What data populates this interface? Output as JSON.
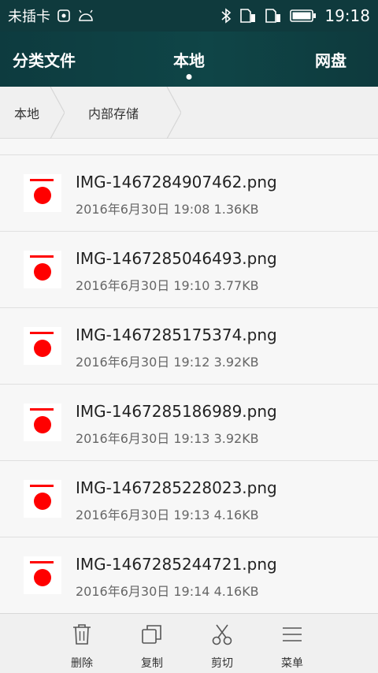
{
  "status_bar": {
    "carrier": "未插卡",
    "time": "19:18"
  },
  "header": {
    "tabs": [
      {
        "label": "分类文件"
      },
      {
        "label": "本地"
      },
      {
        "label": "网盘"
      }
    ]
  },
  "breadcrumb": [
    "本地",
    "内部存储"
  ],
  "files": [
    {
      "name": "IMG-1467284907462.png",
      "date": "2016年6月30日 19:08",
      "size": "1.36KB"
    },
    {
      "name": "IMG-1467285046493.png",
      "date": "2016年6月30日 19:10",
      "size": "3.77KB"
    },
    {
      "name": "IMG-1467285175374.png",
      "date": "2016年6月30日 19:12",
      "size": "3.92KB"
    },
    {
      "name": "IMG-1467285186989.png",
      "date": "2016年6月30日 19:13",
      "size": "3.92KB"
    },
    {
      "name": "IMG-1467285228023.png",
      "date": "2016年6月30日 19:13",
      "size": "4.16KB"
    },
    {
      "name": "IMG-1467285244721.png",
      "date": "2016年6月30日 19:14",
      "size": "4.16KB"
    }
  ],
  "bottom_actions": [
    {
      "label": "删除",
      "icon": "trash-icon"
    },
    {
      "label": "复制",
      "icon": "copy-icon"
    },
    {
      "label": "剪切",
      "icon": "scissors-icon"
    },
    {
      "label": "菜单",
      "icon": "menu-icon"
    }
  ],
  "colors": {
    "header_bg": "#0f4547",
    "thumb_red": "#ff0000"
  }
}
